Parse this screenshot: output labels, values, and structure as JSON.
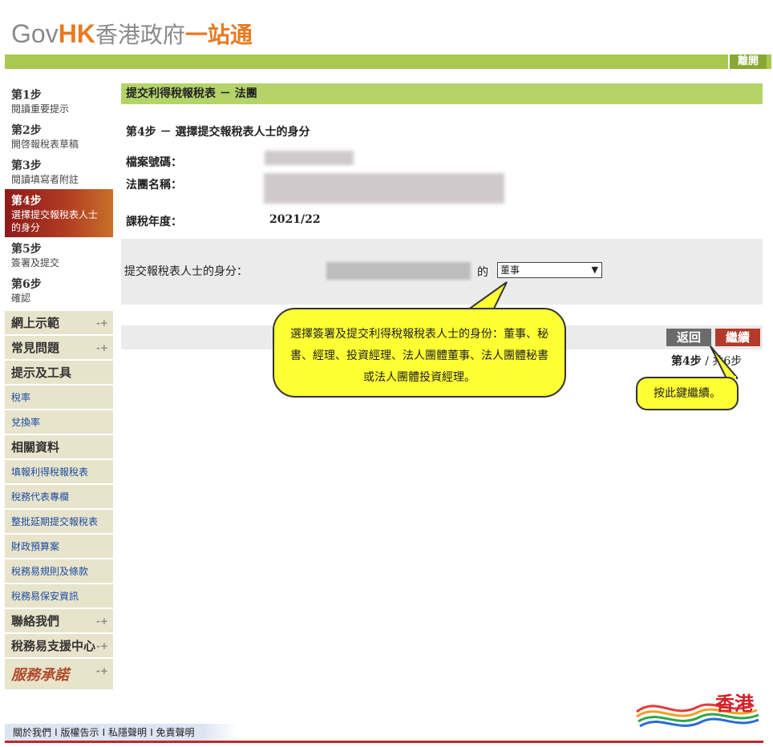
{
  "header": {
    "logo_gov": "Gov",
    "logo_hk": "HK",
    "logo_zh1": "香港政府",
    "logo_zh2": "一站通",
    "logout_label": "離開"
  },
  "sidebar": {
    "steps": [
      {
        "num": "第1步",
        "desc": "閱讀重要提示"
      },
      {
        "num": "第2步",
        "desc": "開啓報稅表草稿"
      },
      {
        "num": "第3步",
        "desc": "閱讀填寫者附註"
      },
      {
        "num": "第4步",
        "desc": "選擇提交報稅表人士的身分"
      },
      {
        "num": "第5步",
        "desc": "簽署及提交"
      },
      {
        "num": "第6步",
        "desc": "確認"
      }
    ],
    "menu": {
      "online_demo": "網上示範",
      "faq": "常見問題",
      "tips_tools": "提示及工具",
      "tax_rate": "稅率",
      "exchange_rate": "兌換率",
      "related_info": "相關資料",
      "fill_return": "填報利得稅報稅表",
      "tax_rep": "稅務代表專欄",
      "bulk_ext": "整批延期提交報稅表",
      "budget": "財政預算案",
      "terms": "稅務易規則及條款",
      "security": "稅務易保安資訊",
      "contact": "聯絡我們",
      "support": "稅務易支援中心",
      "pledge": "服務承諾"
    }
  },
  "main": {
    "title": "提交利得稅報稅表 － 法團",
    "step_title": "第4步 － 選擇提交報稅表人士的身分",
    "file_no_label": "檔案號碼：",
    "corp_name_label": "法團名稱：",
    "year_label": "課稅年度：",
    "year_value": "2021/22",
    "role_label": "提交報稅表人士的身分：",
    "role_of": "的",
    "role_selected": "董事",
    "back_label": "返回",
    "continue_label": "繼續",
    "step_current": "第4步",
    "step_total": "/ 共6步"
  },
  "callouts": {
    "role_help": "選擇簽署及提交利得稅報稅表人士的身份：董事、秘書、經理、投資經理、法人團體董事、法人團體秘書或法人團體投資經理。",
    "continue_help": "按此鍵繼續。"
  },
  "footer": {
    "about": "關於我們",
    "copyright": "版權告示",
    "privacy": "私隱聲明",
    "disclaimer": "免責聲明",
    "brand_text": "香港"
  },
  "colors": {
    "green_bar": "#a8c84e",
    "title_bar": "#b4d46a",
    "active_step": "#a02a1e",
    "continue_btn": "#b23a2a",
    "callout": "#ffff33"
  }
}
